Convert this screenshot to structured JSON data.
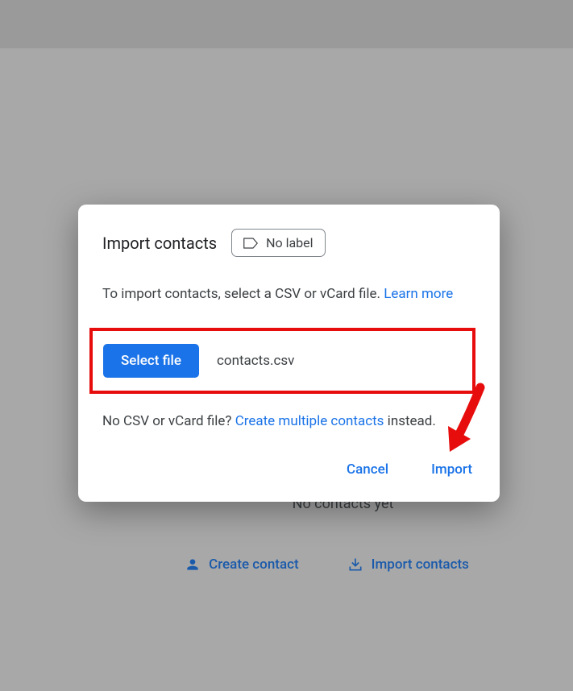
{
  "background": {
    "no_contacts_text": "No contacts yet",
    "create_contact_label": "Create contact",
    "import_contacts_label": "Import contacts"
  },
  "dialog": {
    "title": "Import contacts",
    "label_chip": "No label",
    "instruction_prefix": "To import contacts, select a CSV or vCard file. ",
    "learn_more": "Learn more",
    "select_file_button": "Select file",
    "selected_filename": "contacts.csv",
    "no_csv_prefix": "No CSV or vCard file? ",
    "create_multiple_link": "Create multiple contacts",
    "no_csv_suffix": " instead.",
    "cancel_label": "Cancel",
    "import_label": "Import"
  }
}
